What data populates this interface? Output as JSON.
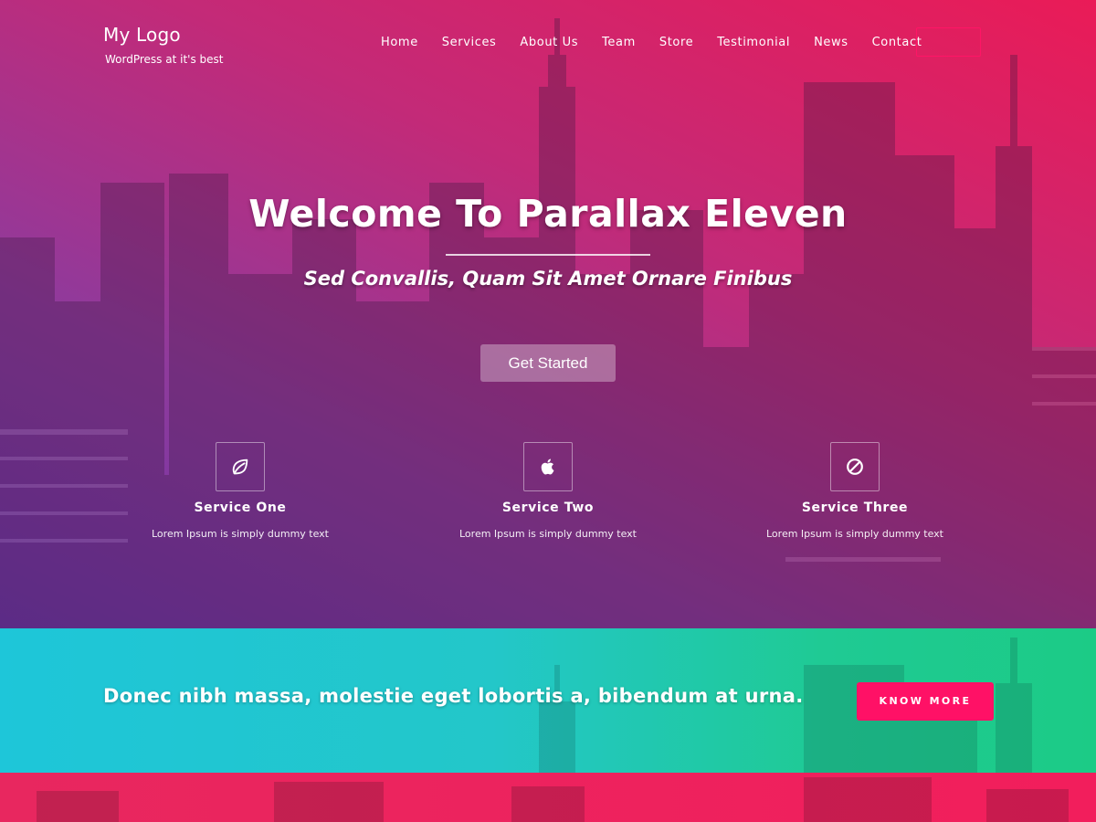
{
  "header": {
    "logo_title": "My Logo",
    "logo_tagline": "WordPress at it's best",
    "nav": [
      "Home",
      "Services",
      "About Us",
      "Team",
      "Store",
      "Testimonial",
      "News",
      "Contact"
    ]
  },
  "hero": {
    "title": "Welcome To Parallax Eleven",
    "subtitle": "Sed Convallis, Quam Sit Amet Ornare Finibus",
    "cta_label": "Get Started"
  },
  "services": [
    {
      "icon": "leaf-icon",
      "title": "Service One",
      "desc": "Lorem Ipsum is simply dummy text"
    },
    {
      "icon": "apple-icon",
      "title": "Service Two",
      "desc": "Lorem Ipsum is simply dummy text"
    },
    {
      "icon": "ban-icon",
      "title": "Service Three",
      "desc": "Lorem Ipsum is simply dummy text"
    }
  ],
  "band": {
    "text": "Donec nibh massa, molestie eget lobortis a, bibendum at urna.",
    "button_label": "KNOW MORE"
  },
  "colors": {
    "accent": "#ff1166",
    "hero_top": "#ea1b57",
    "hero_bottom": "#6c35a8",
    "band_left": "#1ec6d9",
    "band_right": "#1ccb86"
  }
}
